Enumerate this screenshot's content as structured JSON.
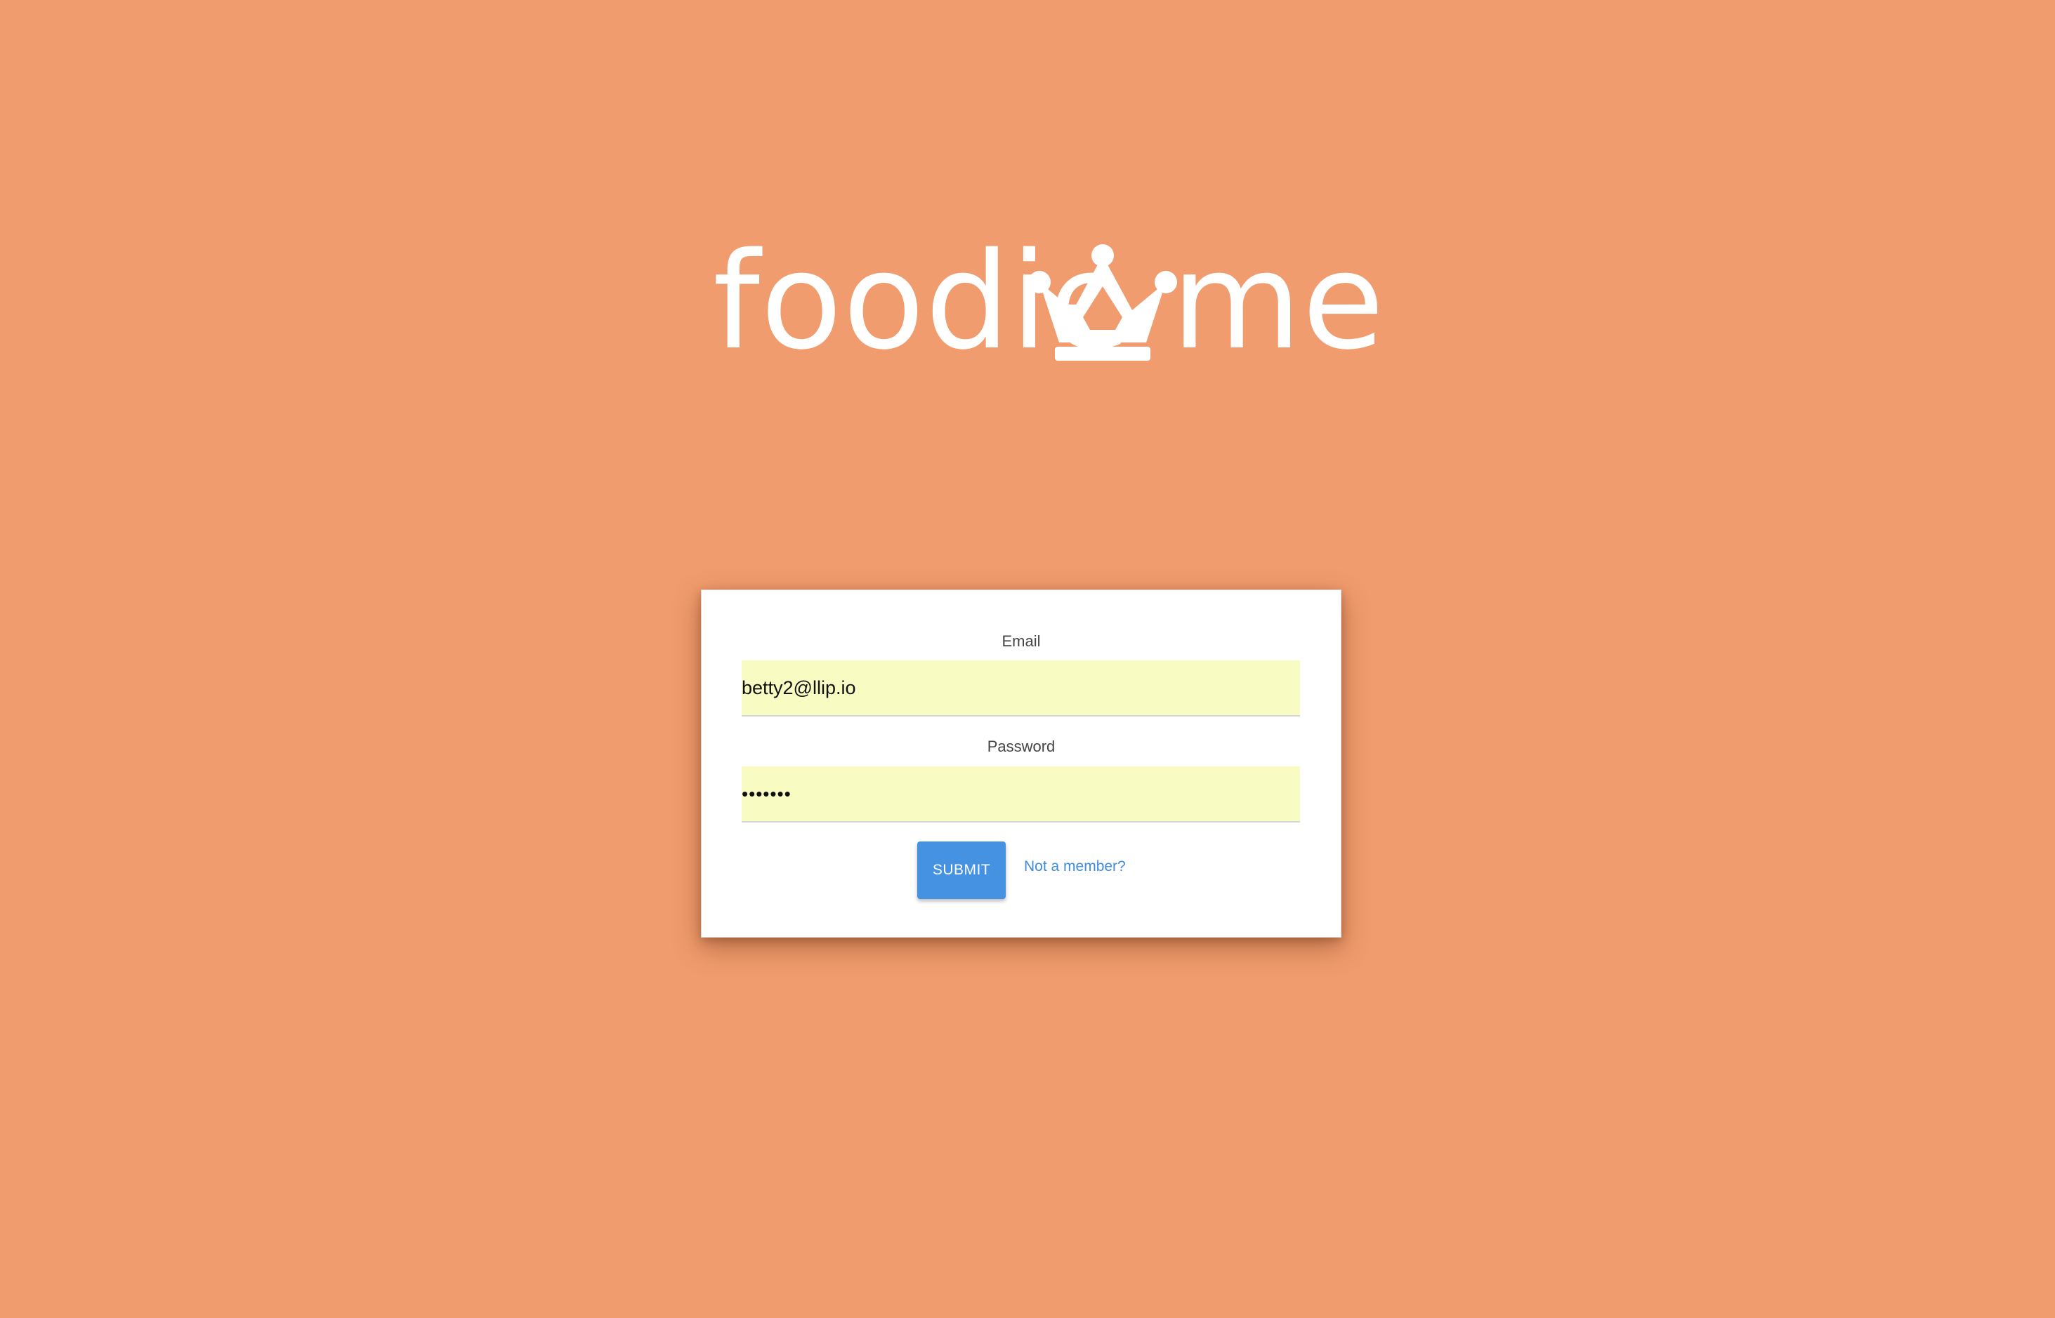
{
  "logo": {
    "text_left": "foodie",
    "text_right": "me",
    "icon": "crown-icon"
  },
  "login_form": {
    "email_label": "Email",
    "email_value": "betty2@llip.io",
    "password_label": "Password",
    "password_value": "•••••••",
    "submit_label": "SUBMIT",
    "signup_link_label": "Not a member?"
  },
  "colors": {
    "background": "#F09C6E",
    "card": "#FFFFFF",
    "input_fill": "#F8FCC2",
    "button": "#4592E3",
    "link": "#3E8BE0"
  }
}
